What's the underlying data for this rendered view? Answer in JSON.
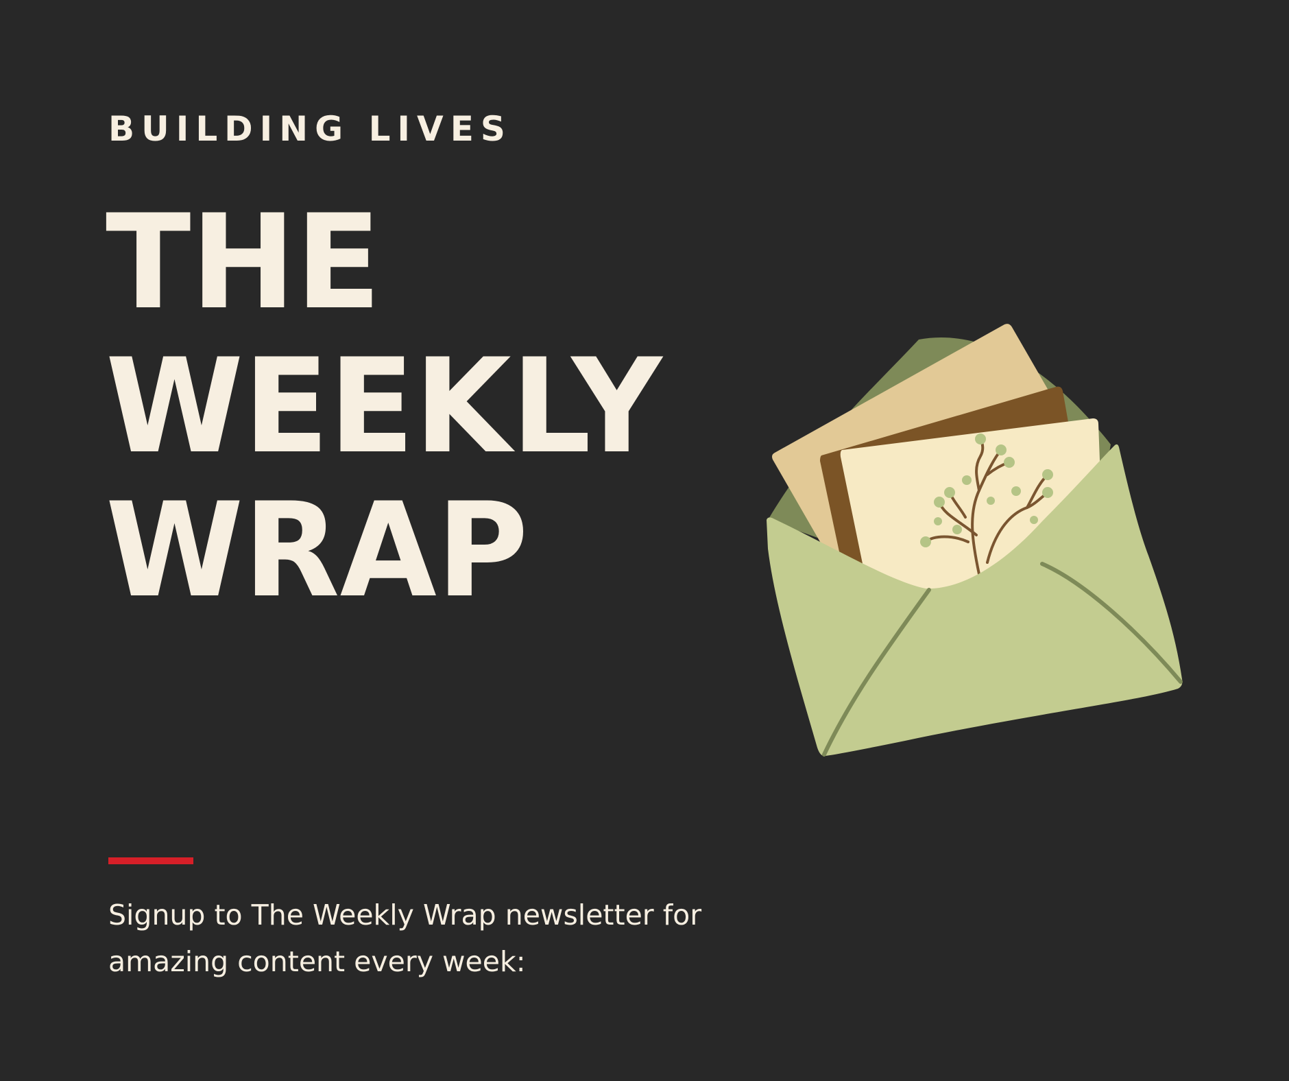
{
  "eyebrow": "BUILDING LIVES",
  "headline": {
    "line1": "THE",
    "line2": "WEEKLY",
    "line3": "WRAP"
  },
  "signup_text": "Signup to The Weekly Wrap newsletter for amazing content every week:",
  "illustration": {
    "icon": "envelope-with-letters-icon",
    "branch_icon": "flower-branch-icon"
  },
  "colors": {
    "background": "#282828",
    "text": "#f7efe1",
    "accent": "#d71f28",
    "envelope_front": "#c3cc90",
    "envelope_back": "#7e8a58",
    "letter_tan": "#e2c996",
    "letter_brown": "#7b5426",
    "letter_cream": "#f7eac4"
  }
}
